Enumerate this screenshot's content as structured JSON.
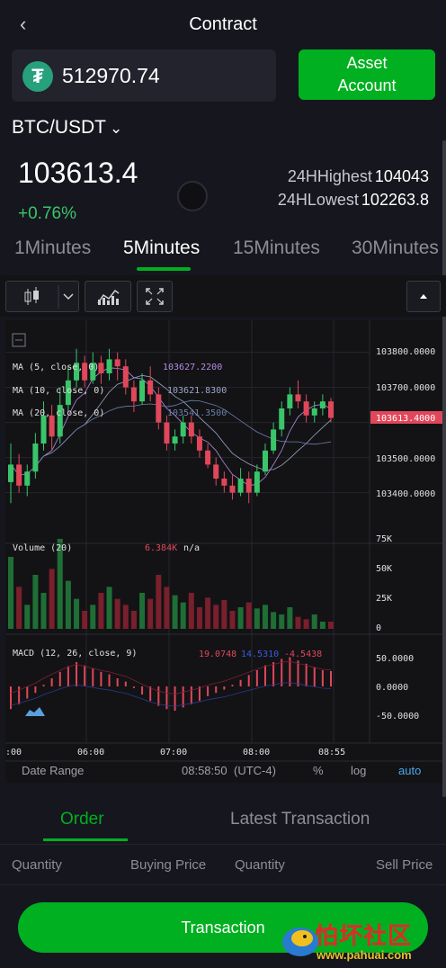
{
  "header": {
    "title": "Contract",
    "back_icon": "chevron-left-icon"
  },
  "balance": {
    "icon": "tether-icon",
    "icon_glyph": "₮",
    "value": "512970.74"
  },
  "asset_button": {
    "label_line1": "Asset",
    "label_line2": "Account"
  },
  "pair": {
    "label": "BTC/USDT",
    "chevron": "⌄"
  },
  "ticker": {
    "price": "103613.4",
    "change": "+0.76%",
    "high_label": "24HHighest",
    "high_value": "104043",
    "low_label": "24HLowest",
    "low_value": "102263.8"
  },
  "timeframes": [
    "1Minutes",
    "5Minutes",
    "15Minutes",
    "30Minutes"
  ],
  "active_timeframe": "5Minutes",
  "colors": {
    "accent": "#00b020",
    "up": "#3ac56a",
    "down": "#e0475a",
    "background": "#16161e"
  },
  "chart_data": {
    "type": "candlestick",
    "price_axis_ticks": [
      "103800.0000",
      "103700.0000",
      "103600.0000",
      "103500.0000",
      "103400.0000"
    ],
    "current_price_label": "103613.4000",
    "ma_legends": [
      {
        "label": "MA (5, close, 0)",
        "value": "103627.2200",
        "color": "#b48ce0"
      },
      {
        "label": "MA (10, close, 0)",
        "value": "103621.8300",
        "color": "#9aa6c8"
      },
      {
        "label": "MA (20, close, 0)",
        "value": "103541.3500",
        "color": "#6f7ea8"
      }
    ],
    "volume": {
      "label": "Volume (20)",
      "value": "6.384K",
      "extra": "n/a",
      "ticks": [
        "75K",
        "50K",
        "25K",
        "0"
      ]
    },
    "macd": {
      "label": "MACD (12, 26, close, 9)",
      "values": [
        "19.0748",
        "14.5310",
        "-4.5438"
      ],
      "ticks": [
        "50.0000",
        "0.0000",
        "-50.0000"
      ]
    },
    "time_ticks": [
      ":00",
      "06:00",
      "07:00",
      "08:00",
      "08:55"
    ],
    "candles": [
      [
        103430,
        103480,
        103370,
        103540
      ],
      [
        103480,
        103420,
        103400,
        103510
      ],
      [
        103420,
        103460,
        103390,
        103480
      ],
      [
        103460,
        103540,
        103440,
        103570
      ],
      [
        103540,
        103620,
        103520,
        103660
      ],
      [
        103620,
        103560,
        103520,
        103650
      ],
      [
        103560,
        103650,
        103540,
        103700
      ],
      [
        103650,
        103720,
        103630,
        103760
      ],
      [
        103720,
        103770,
        103700,
        103810
      ],
      [
        103770,
        103720,
        103700,
        103790
      ],
      [
        103720,
        103770,
        103710,
        103800
      ],
      [
        103770,
        103740,
        103710,
        103790
      ],
      [
        103740,
        103780,
        103720,
        103810
      ],
      [
        103780,
        103760,
        103720,
        103800
      ],
      [
        103760,
        103700,
        103680,
        103780
      ],
      [
        103700,
        103660,
        103630,
        103720
      ],
      [
        103660,
        103720,
        103650,
        103740
      ],
      [
        103720,
        103680,
        103660,
        103760
      ],
      [
        103680,
        103600,
        103580,
        103700
      ],
      [
        103600,
        103540,
        103520,
        103620
      ],
      [
        103540,
        103560,
        103520,
        103580
      ],
      [
        103560,
        103600,
        103540,
        103620
      ],
      [
        103600,
        103560,
        103540,
        103620
      ],
      [
        103560,
        103520,
        103500,
        103580
      ],
      [
        103520,
        103480,
        103470,
        103540
      ],
      [
        103480,
        103440,
        103420,
        103500
      ],
      [
        103440,
        103420,
        103400,
        103460
      ],
      [
        103420,
        103400,
        103380,
        103450
      ],
      [
        103400,
        103440,
        103390,
        103470
      ],
      [
        103440,
        103400,
        103370,
        103460
      ],
      [
        103400,
        103460,
        103390,
        103480
      ],
      [
        103460,
        103520,
        103450,
        103540
      ],
      [
        103520,
        103580,
        103510,
        103600
      ],
      [
        103580,
        103640,
        103560,
        103660
      ],
      [
        103640,
        103680,
        103620,
        103700
      ],
      [
        103680,
        103660,
        103640,
        103720
      ],
      [
        103660,
        103620,
        103600,
        103680
      ],
      [
        103620,
        103640,
        103600,
        103660
      ],
      [
        103640,
        103660,
        103620,
        103680
      ],
      [
        103660,
        103613,
        103600,
        103670
      ]
    ],
    "volumes": [
      60,
      35,
      20,
      45,
      30,
      50,
      75,
      40,
      25,
      15,
      20,
      30,
      35,
      25,
      20,
      15,
      30,
      25,
      45,
      35,
      28,
      22,
      30,
      18,
      26,
      20,
      24,
      15,
      18,
      22,
      17,
      20,
      14,
      12,
      18,
      10,
      8,
      12,
      6,
      6
    ],
    "macd_hist": [
      -28,
      -22,
      -15,
      -8,
      2,
      10,
      18,
      25,
      30,
      26,
      22,
      18,
      15,
      10,
      6,
      -2,
      -10,
      -18,
      -24,
      -28,
      -30,
      -26,
      -22,
      -18,
      -12,
      -8,
      -4,
      2,
      8,
      14,
      20,
      26,
      30,
      34,
      36,
      32,
      28,
      24,
      20,
      19
    ],
    "buttons": {
      "date_range": "Date Range",
      "time": "08:58:50",
      "timezone": "(UTC-4)",
      "percent": "%",
      "log": "log",
      "auto": "auto"
    }
  },
  "order_tabs": {
    "order": "Order",
    "latest": "Latest Transaction"
  },
  "columns": [
    "Quantity",
    "Buying Price",
    "Quantity",
    "Sell Price"
  ],
  "transaction_button": "Transaction",
  "watermark": {
    "text": "怕坏社区",
    "url": "www.pahuai.com"
  }
}
